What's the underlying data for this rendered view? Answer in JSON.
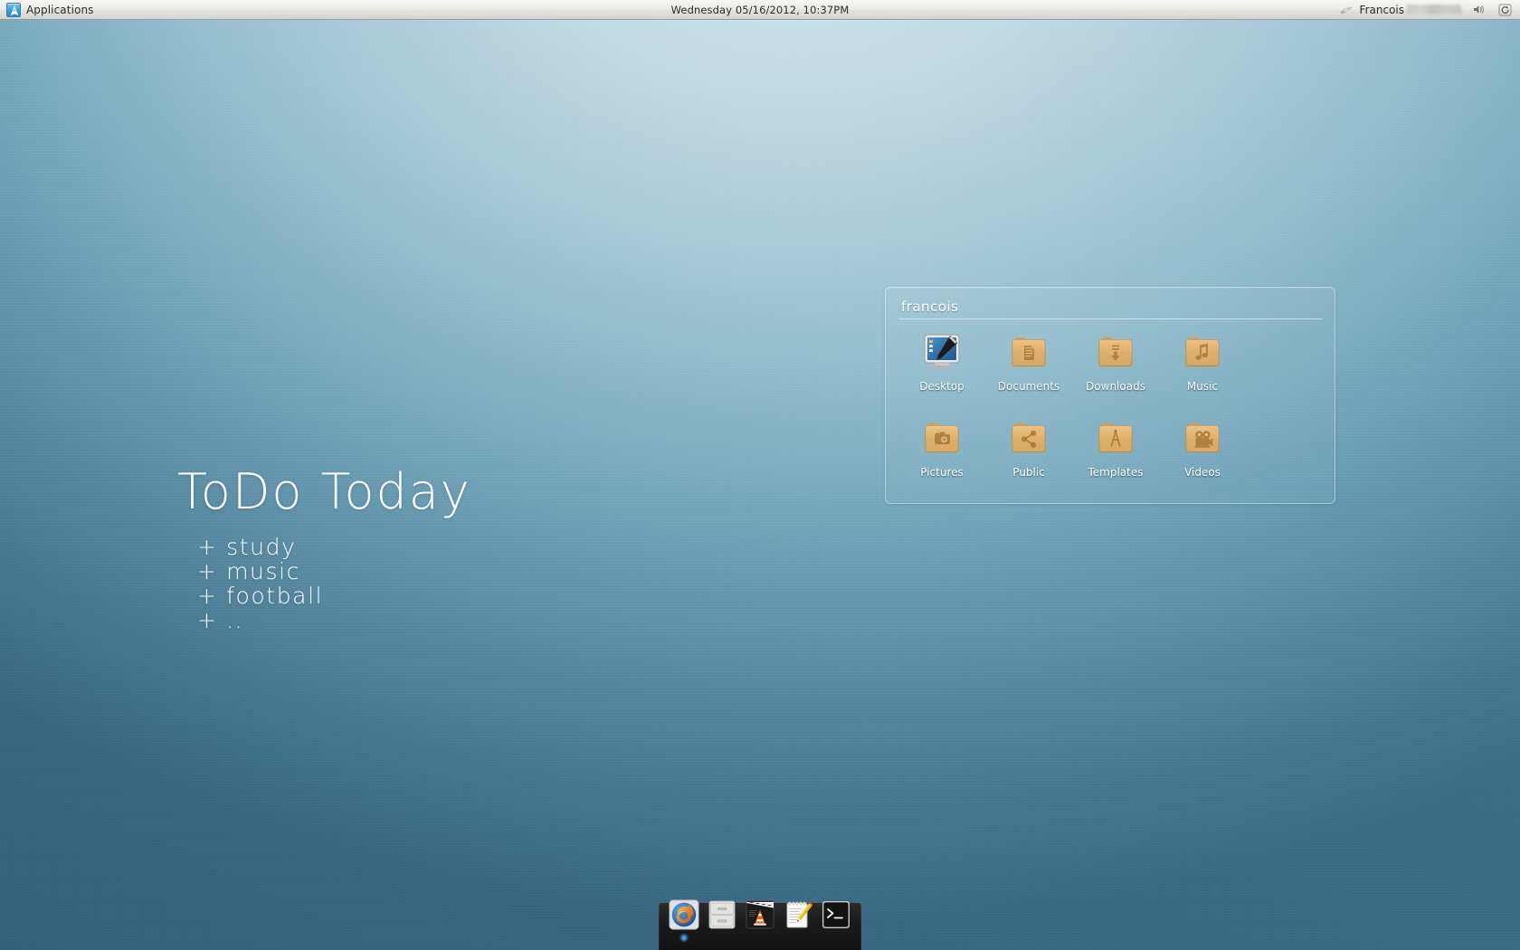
{
  "panel": {
    "applications_label": "Applications",
    "applications_icon": "arch-logo-icon",
    "clock": "Wednesday 05/16/2012, 10:37PM",
    "user_name": "Francois",
    "user_icon": "pen-nib-icon",
    "tray": [
      {
        "name": "volume-icon",
        "label": ""
      },
      {
        "name": "power-restart-icon",
        "label": ""
      }
    ]
  },
  "folderview": {
    "title": "francois",
    "items": [
      {
        "label": "Desktop",
        "icon": "desktop-preview-icon"
      },
      {
        "label": "Documents",
        "icon": "documents-folder-icon"
      },
      {
        "label": "Downloads",
        "icon": "downloads-folder-icon"
      },
      {
        "label": "Music",
        "icon": "music-folder-icon"
      },
      {
        "label": "Pictures",
        "icon": "pictures-folder-icon"
      },
      {
        "label": "Public",
        "icon": "public-share-folder-icon"
      },
      {
        "label": "Templates",
        "icon": "templates-folder-icon"
      },
      {
        "label": "Videos",
        "icon": "videos-folder-icon"
      }
    ]
  },
  "todo": {
    "title": "ToDo Today",
    "items": [
      "+ study",
      "+ music",
      "+ football",
      "+ .."
    ]
  },
  "dock": {
    "items": [
      {
        "name": "firefox-icon",
        "label": "Firefox",
        "running": true
      },
      {
        "name": "file-manager-icon",
        "label": "File Manager",
        "running": false
      },
      {
        "name": "vlc-icon",
        "label": "VLC",
        "running": false
      },
      {
        "name": "notes-icon",
        "label": "Notes",
        "running": false
      },
      {
        "name": "terminal-icon",
        "label": "Terminal",
        "running": false
      }
    ]
  },
  "colors": {
    "wallpaper_top": "#cfe3ea",
    "wallpaper_bottom": "#3f6f88",
    "panel_bg": "#ebeae8",
    "folder_tan": "#dca95f",
    "accent_blue": "#3f9ed4"
  }
}
